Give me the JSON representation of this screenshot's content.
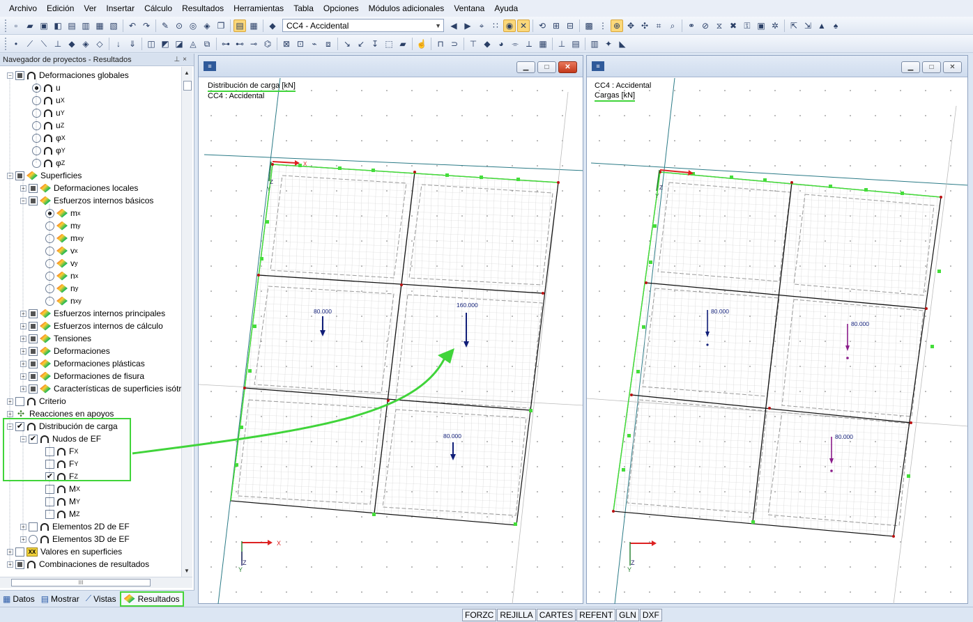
{
  "menu": [
    "Archivo",
    "Edición",
    "Ver",
    "Insertar",
    "Cálculo",
    "Resultados",
    "Herramientas",
    "Tabla",
    "Opciones",
    "Módulos adicionales",
    "Ventana",
    "Ayuda"
  ],
  "toolbar": {
    "load_case": "CC4 - Accidental"
  },
  "navigator": {
    "title": "Navegador de proyectos - Resultados",
    "items": {
      "def_globales": "Deformaciones globales",
      "u": "u",
      "ux": "u",
      "ux_sub": "X",
      "uy": "u",
      "uy_sub": "Y",
      "uz": "u",
      "uz_sub": "Z",
      "phix": "φ",
      "phix_sub": "X",
      "phiy": "φ",
      "phiy_sub": "Y",
      "phiz": "φ",
      "phiz_sub": "Z",
      "superficies": "Superficies",
      "def_locales": "Deformaciones locales",
      "esf_basicos": "Esfuerzos internos básicos",
      "mx": "m",
      "mx_sub": "x",
      "my": "m",
      "my_sub": "y",
      "mxy": "m",
      "mxy_sub": "xy",
      "vx": "v",
      "vx_sub": "x",
      "vy": "v",
      "vy_sub": "y",
      "nx": "n",
      "nx_sub": "x",
      "ny": "n",
      "ny_sub": "y",
      "nxy": "n",
      "nxy_sub": "xy",
      "esf_principales": "Esfuerzos internos principales",
      "esf_calculo": "Esfuerzos internos de cálculo",
      "tensiones": "Tensiones",
      "deformaciones": "Deformaciones",
      "def_plasticas": "Deformaciones plásticas",
      "def_fisura": "Deformaciones de fisura",
      "caracteristicas": "Características de superficies isótr",
      "criterio": "Criterio",
      "reacciones": "Reacciones en apoyos",
      "distribucion": "Distribución de carga",
      "nudos_ef": "Nudos de EF",
      "fx": "F",
      "fx_sub": "X",
      "fy": "F",
      "fy_sub": "Y",
      "fz": "F",
      "fz_sub": "Z",
      "mxm": "M",
      "mxm_sub": "X",
      "mym": "M",
      "mym_sub": "Y",
      "mzm": "M",
      "mzm_sub": "Z",
      "elem2d": "Elementos 2D de EF",
      "elem3d": "Elementos 3D de EF",
      "valores": "Valores en superficies",
      "combinaciones": "Combinaciones de resultados"
    },
    "tabs": {
      "datos": "Datos",
      "mostrar": "Mostrar",
      "vistas": "Vistas",
      "resultados": "Resultados"
    },
    "scroll_glyph": "III"
  },
  "window_left": {
    "title_line1": "Distribución de carga [kN]",
    "title_line2": "CC4 : Accidental",
    "loads": [
      "80.000",
      "160.000",
      "80.000"
    ],
    "axis": {
      "x": "X",
      "y": "Y",
      "z": "Z"
    }
  },
  "window_right": {
    "title_line1": "CC4 : Accidental",
    "title_line2": "Cargas [kN]",
    "loads": [
      "80.000",
      "80.000",
      "80.000"
    ],
    "axis": {
      "x": "X",
      "y": "Y",
      "z": "Z"
    }
  },
  "status": [
    "FORZC",
    "REJILLA",
    "CARTES",
    "REFENT",
    "GLN",
    "DXF"
  ],
  "colors": {
    "accent_green": "#40d43a",
    "load_arrow": "#101e78",
    "load_arrow_right": "#8a1c8a"
  }
}
